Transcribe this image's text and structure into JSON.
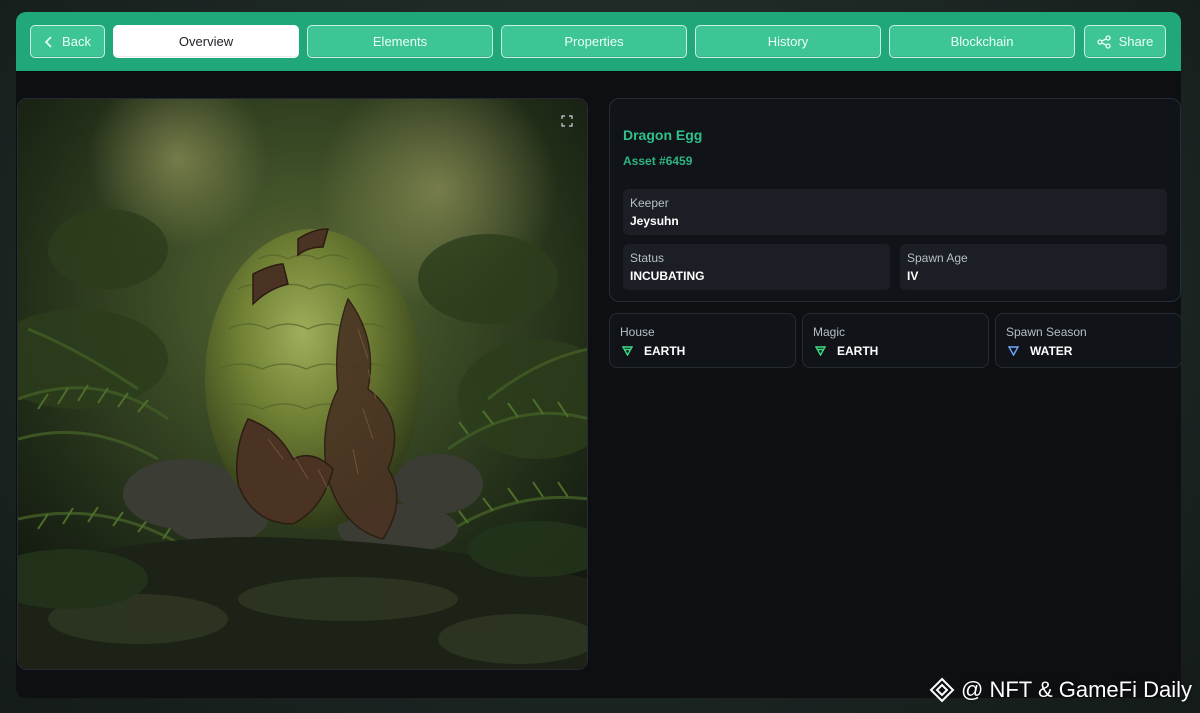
{
  "nav": {
    "back_label": "Back",
    "tabs": [
      {
        "label": "Overview",
        "active": true
      },
      {
        "label": "Elements",
        "active": false
      },
      {
        "label": "Properties",
        "active": false
      },
      {
        "label": "History",
        "active": false
      },
      {
        "label": "Blockchain",
        "active": false
      }
    ],
    "share_label": "Share"
  },
  "asset": {
    "name": "Dragon Egg",
    "id_label": "Asset #6459",
    "image_subject": "dragon egg in forest"
  },
  "details": {
    "keeper_label": "Keeper",
    "keeper_value": "Jeysuhn",
    "status_label": "Status",
    "status_value": "INCUBATING",
    "spawn_age_label": "Spawn Age",
    "spawn_age_value": "IV"
  },
  "attributes": [
    {
      "label": "House",
      "value": "EARTH",
      "icon": "earth-triangle-icon",
      "color": "#3ddc84"
    },
    {
      "label": "Magic",
      "value": "EARTH",
      "icon": "earth-triangle-icon",
      "color": "#3ddc84"
    },
    {
      "label": "Spawn Season",
      "value": "WATER",
      "icon": "water-triangle-icon",
      "color": "#6fa8ff"
    }
  ],
  "watermark": "@ NFT & GameFi Daily",
  "colors": {
    "accent": "#20a87b",
    "button": "#3ec595",
    "panel": "#101318"
  }
}
